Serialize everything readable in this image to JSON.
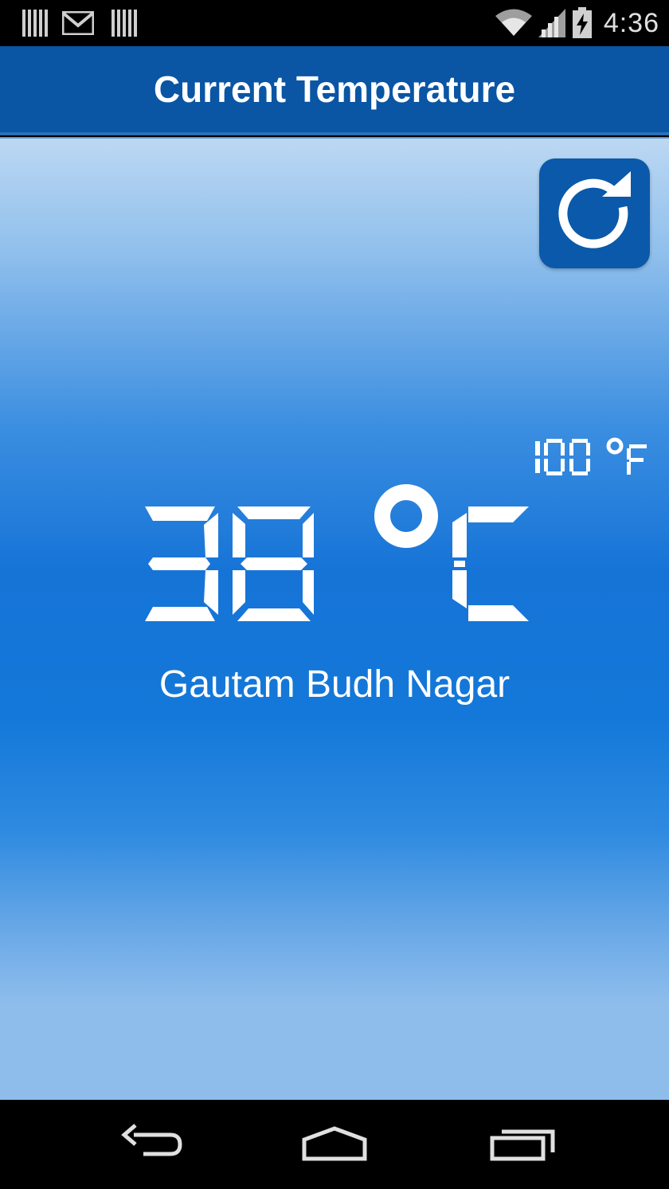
{
  "status_bar": {
    "time": "4:36",
    "icons": [
      "barcode-icon",
      "gmail-icon",
      "barcode-icon",
      "wifi-icon",
      "signal-icon",
      "battery-charging-icon"
    ]
  },
  "action_bar": {
    "title": "Current Temperature"
  },
  "temperature": {
    "celsius_value": "38",
    "celsius_unit": "°C",
    "fahrenheit_value": "100",
    "fahrenheit_unit": "°F"
  },
  "location": {
    "city": "Gautam Budh Nagar"
  },
  "refresh": {
    "icon": "refresh-icon"
  },
  "nav_bar": {
    "buttons": [
      "back-icon",
      "home-icon",
      "recent-apps-icon"
    ]
  },
  "colors": {
    "action_bar": "#0a55a4",
    "refresh_button": "#0b59aa",
    "text": "#ffffff"
  }
}
